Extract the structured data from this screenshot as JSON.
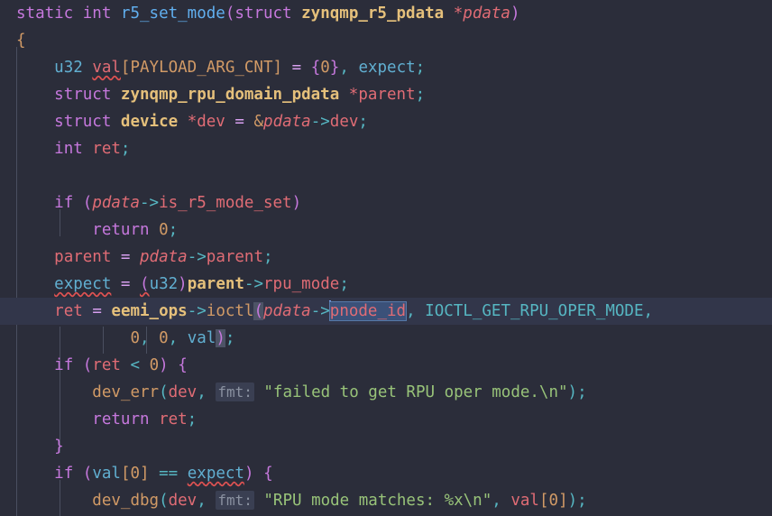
{
  "editor": {
    "language": "c",
    "font_size_px": 17.5,
    "line_height_px": 30,
    "background": "#2b2d3a",
    "current_line_background": "#32364a",
    "selection_background": "#3b5179",
    "caret_color": "#7aa2f7",
    "current_line_index": 11,
    "cursor": {
      "line": 11,
      "column_token": "pnode_id"
    },
    "selected_text": "pnode_id"
  },
  "colors": {
    "keyword": "#c678dd",
    "type": "#61afd1",
    "function": "#61afef",
    "variable": "#e06c75",
    "parameter_italic": "#e06c75",
    "number": "#d19a66",
    "bracket": "#d19a66",
    "paren": "#c678dd",
    "punctuation": "#56b6c2",
    "operator": "#d8a0f0",
    "string": "#98c379",
    "constant": "#56b6c2",
    "call": "#d19a66",
    "bold_field": "#e5c07b",
    "parameter_hint_fg": "#8a91a0",
    "parameter_hint_bg": "#3a3f52",
    "error_squiggle": "#e05252",
    "indent_guide": "#4a4f60"
  },
  "code": {
    "lines": [
      "static int r5_set_mode(struct zynqmp_r5_pdata *pdata)",
      "{",
      "    u32 val[PAYLOAD_ARG_CNT] = {0}, expect;",
      "    struct zynqmp_rpu_domain_pdata *parent;",
      "    struct device *dev = &pdata->dev;",
      "    int ret;",
      "",
      "    if (pdata->is_r5_mode_set)",
      "        return 0;",
      "    parent = pdata->parent;",
      "    expect = (u32)parent->rpu_mode;",
      "    ret = eemi_ops->ioctl(pdata->pnode_id, IOCTL_GET_RPU_OPER_MODE,",
      "            0, 0, val);",
      "    if (ret < 0) {",
      "        dev_err(dev, fmt: \"failed to get RPU oper mode.\\n\");",
      "        return ret;",
      "    }",
      "    if (val[0] == expect) {",
      "        dev_dbg(dev, fmt: \"RPU mode matches: %x\\n\", val[0]);"
    ],
    "parameter_hints": [
      "fmt:",
      "fmt:"
    ],
    "strings": [
      "\"failed to get RPU oper mode.\\n\"",
      "\"RPU mode matches: %x\\n\""
    ],
    "constants": [
      "PAYLOAD_ARG_CNT",
      "IOCTL_GET_RPU_OPER_MODE"
    ],
    "error_underlined_tokens": [
      "val",
      "expect",
      "(u32)"
    ],
    "function_name": "r5_set_mode",
    "types": [
      "zynqmp_r5_pdata",
      "zynqmp_rpu_domain_pdata",
      "device",
      "u32",
      "int"
    ],
    "calls": [
      "eemi_ops",
      "ioctl",
      "dev_err",
      "dev_dbg"
    ]
  }
}
